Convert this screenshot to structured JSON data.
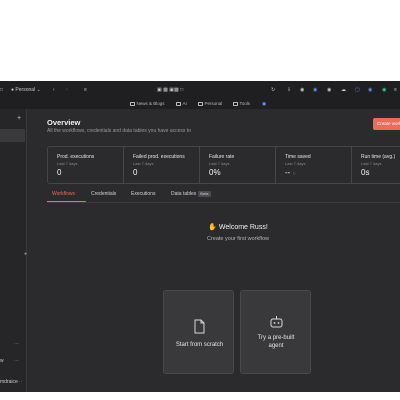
{
  "browser": {
    "profile": "Personal",
    "bookmarks": [
      "News & Blogs",
      "AI",
      "Personal",
      "Tools"
    ]
  },
  "sidebar": {
    "items": [
      "w",
      "mdraice"
    ]
  },
  "overview": {
    "title": "Overview",
    "subtitle": "All the workflows, credentials and data tables you have access to",
    "create_label": "Create work"
  },
  "stats": [
    {
      "label": "Prod. executions",
      "period": "Last 7 days",
      "value": "0"
    },
    {
      "label": "Failed prod. executions",
      "period": "Last 7 days",
      "value": "0"
    },
    {
      "label": "Failure rate",
      "period": "Last 7 days",
      "value": "0%"
    },
    {
      "label": "Time saved",
      "period": "Last 7 days",
      "value": "--"
    },
    {
      "label": "Run time (avg.)",
      "period": "Last 7 days",
      "value": "0s"
    }
  ],
  "tabs": [
    "Workflows",
    "Credentials",
    "Executions",
    "Data tables"
  ],
  "beta_badge": "Beta",
  "welcome": {
    "heading": "Welcome Russ!",
    "subtitle": "Create your first workflow",
    "cards": [
      "Start from scratch",
      "Try a pre-built agent"
    ]
  },
  "colors": {
    "accent": "#ea6d5b",
    "background": "#2b2b2d"
  }
}
